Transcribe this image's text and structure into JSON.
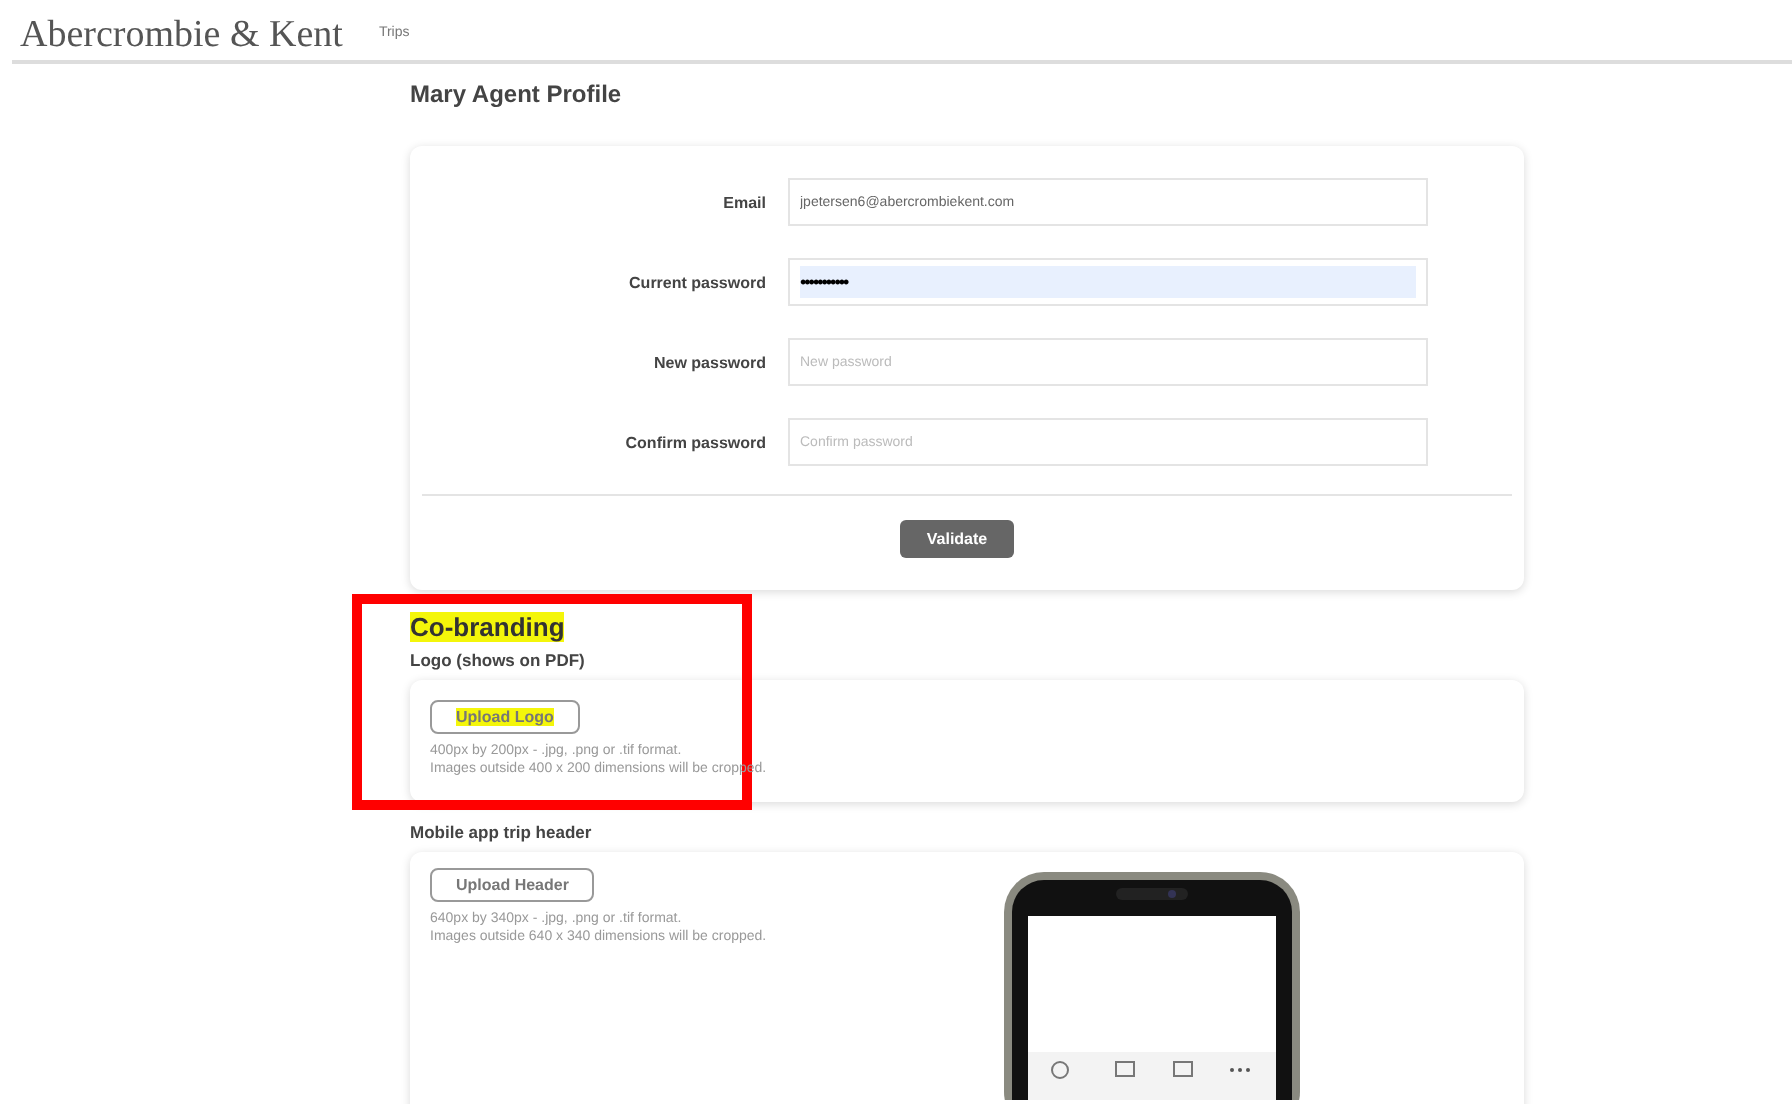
{
  "header": {
    "brand": "Abercrombie & Kent",
    "nav": [
      {
        "label": "Trips"
      }
    ]
  },
  "title": "Mary Agent Profile",
  "profile_form": {
    "fields": [
      {
        "label": "Email",
        "value": "jpetersen6@abercrombiekent.com",
        "autofilled": false,
        "kind": "email"
      },
      {
        "label": "Current password",
        "value": "•••••••••••",
        "autofilled": true,
        "kind": "password"
      },
      {
        "label": "New password",
        "placeholder": "New password",
        "autofilled": false,
        "kind": "password"
      },
      {
        "label": "Confirm password",
        "placeholder": "Confirm password",
        "autofilled": false,
        "kind": "password"
      }
    ],
    "submit": "Validate"
  },
  "cobranding": {
    "heading": "Co-branding",
    "highlighted": true,
    "sections": [
      {
        "label": "Logo (shows on PDF)",
        "button": "Upload Logo",
        "button_highlighted": true,
        "hints": [
          "400px by 200px - .jpg, .png or .tif format.",
          "Images outside 400 x 200 dimensions will be cropped."
        ],
        "kind": "logo"
      },
      {
        "label": "Mobile app trip header",
        "button": "Upload Header",
        "button_highlighted": false,
        "hints": [
          "640px by 340px - .jpg, .png or .tif format.",
          "Images outside 640 x 340 dimensions will be cropped."
        ],
        "kind": "phone"
      }
    ]
  }
}
